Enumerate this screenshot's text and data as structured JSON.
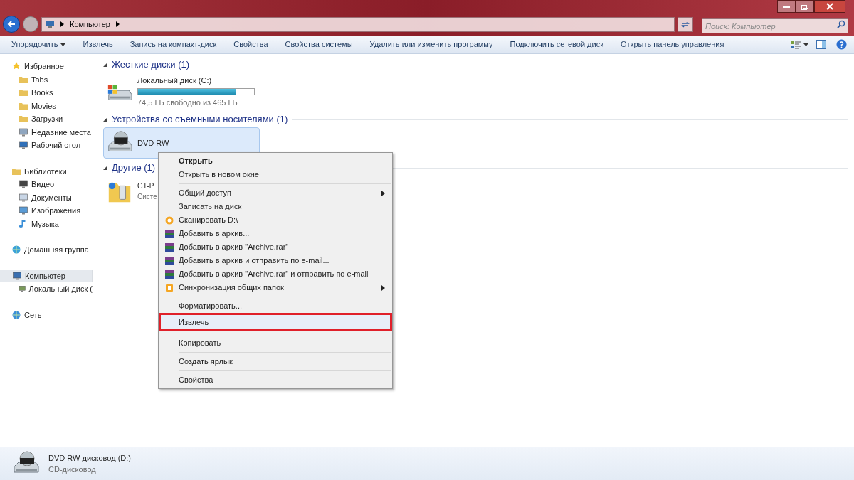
{
  "window": {
    "breadcrumbs": [
      "Компьютер"
    ],
    "search_placeholder": "Поиск: Компьютер"
  },
  "toolbar": [
    {
      "label": "Упорядочить",
      "dropdown": true
    },
    {
      "label": "Извлечь",
      "dropdown": false
    },
    {
      "label": "Запись на компакт-диск",
      "dropdown": false
    },
    {
      "label": "Свойства",
      "dropdown": false
    },
    {
      "label": "Свойства системы",
      "dropdown": false
    },
    {
      "label": "Удалить или изменить программу",
      "dropdown": false
    },
    {
      "label": "Подключить сетевой диск",
      "dropdown": false
    },
    {
      "label": "Открыть панель управления",
      "dropdown": false
    }
  ],
  "sidebar": [
    {
      "label": "Избранное",
      "selected": false,
      "children": [
        {
          "label": "Tabs",
          "selected": false
        },
        {
          "label": "Books",
          "selected": false
        },
        {
          "label": "Movies",
          "selected": false
        },
        {
          "label": "Загрузки",
          "selected": false
        },
        {
          "label": "Недавние места",
          "selected": false
        },
        {
          "label": "Рабочий стол",
          "selected": false
        }
      ]
    },
    {
      "label": "Библиотеки",
      "selected": false,
      "children": [
        {
          "label": "Видео",
          "selected": false
        },
        {
          "label": "Документы",
          "selected": false
        },
        {
          "label": "Изображения",
          "selected": false
        },
        {
          "label": "Музыка",
          "selected": false
        }
      ]
    },
    {
      "label": "Домашняя группа",
      "selected": false
    },
    {
      "label": "Компьютер",
      "selected": true,
      "children": [
        {
          "label": "Локальный диск (",
          "selected": false
        }
      ]
    },
    {
      "label": "Сеть",
      "selected": false
    }
  ],
  "sections": [
    {
      "title": "Жесткие диски (1)",
      "items": [
        {
          "kind": "disk",
          "name": "Локальный диск (C:)",
          "level": 0.84,
          "detail": "74,5 ГБ свободно из 465 ГБ",
          "selected": false
        }
      ]
    },
    {
      "title": "Устройства со съемными носителями (1)",
      "items": [
        {
          "kind": "dvd",
          "name": "DVD RW",
          "selected": true
        }
      ]
    },
    {
      "title": "Другие (1)",
      "items": [
        {
          "kind": "phone",
          "name": "GT-P",
          "detail": "Систе",
          "selected": false
        }
      ]
    }
  ],
  "context_menu": [
    {
      "kind": "plain",
      "label": "Открыть",
      "bold": true,
      "submenu": false,
      "highlighted": false
    },
    {
      "kind": "plain",
      "label": "Открыть в новом окне",
      "bold": false,
      "submenu": false,
      "highlighted": false
    },
    {
      "kind": "separator"
    },
    {
      "kind": "plain",
      "label": "Общий доступ",
      "bold": false,
      "submenu": true,
      "highlighted": false
    },
    {
      "kind": "plain",
      "label": "Записать на диск",
      "bold": false,
      "submenu": false,
      "highlighted": false
    },
    {
      "kind": "scan",
      "label": "Сканировать D:\\",
      "bold": false,
      "submenu": false,
      "highlighted": false
    },
    {
      "kind": "archive",
      "label": "Добавить в архив...",
      "bold": false,
      "submenu": false,
      "highlighted": false
    },
    {
      "kind": "archive",
      "label": "Добавить в архив \"Archive.rar\"",
      "bold": false,
      "submenu": false,
      "highlighted": false
    },
    {
      "kind": "archive",
      "label": "Добавить в архив и отправить по e-mail...",
      "bold": false,
      "submenu": false,
      "highlighted": false
    },
    {
      "kind": "archive",
      "label": "Добавить в архив \"Archive.rar\" и отправить по e-mail",
      "bold": false,
      "submenu": false,
      "highlighted": false
    },
    {
      "kind": "sync",
      "label": "Синхронизация общих папок",
      "bold": false,
      "submenu": true,
      "highlighted": false
    },
    {
      "kind": "separator"
    },
    {
      "kind": "plain",
      "label": "Форматировать...",
      "bold": false,
      "submenu": false,
      "highlighted": false
    },
    {
      "kind": "plain",
      "label": "Извлечь",
      "bold": false,
      "submenu": false,
      "highlighted": true
    },
    {
      "kind": "separator"
    },
    {
      "kind": "plain",
      "label": "Копировать",
      "bold": false,
      "submenu": false,
      "highlighted": false
    },
    {
      "kind": "separator"
    },
    {
      "kind": "plain",
      "label": "Создать ярлык",
      "bold": false,
      "submenu": false,
      "highlighted": false
    },
    {
      "kind": "separator"
    },
    {
      "kind": "plain",
      "label": "Свойства",
      "bold": false,
      "submenu": false,
      "highlighted": false
    }
  ],
  "details": {
    "name": "DVD RW дисковод (D:)",
    "type": "CD-дисковод"
  }
}
